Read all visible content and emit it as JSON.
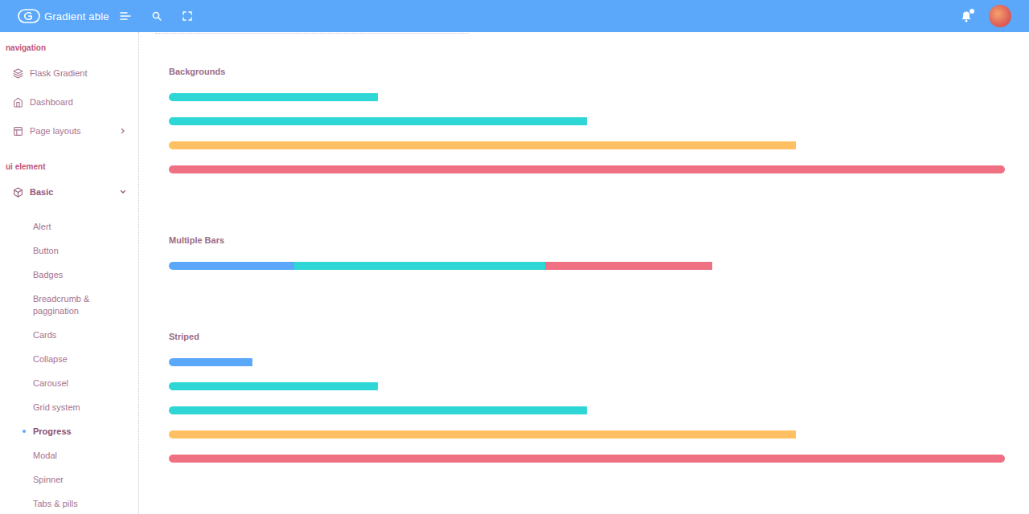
{
  "header": {
    "logo": "Gradient able"
  },
  "sidebar": {
    "groups": [
      {
        "label": "navigation",
        "items": [
          {
            "label": "Flask Gradient"
          },
          {
            "label": "Dashboard"
          },
          {
            "label": "Page layouts",
            "expanded": false
          }
        ]
      },
      {
        "label": "ui element",
        "items": [
          {
            "label": "Basic",
            "expanded": true,
            "children": [
              {
                "label": "Alert",
                "selected": false
              },
              {
                "label": "Button",
                "selected": false
              },
              {
                "label": "Badges",
                "selected": false
              },
              {
                "label": "Breadcrumb & paggination",
                "selected": false
              },
              {
                "label": "Cards",
                "selected": false
              },
              {
                "label": "Collapse",
                "selected": false
              },
              {
                "label": "Carousel",
                "selected": false
              },
              {
                "label": "Grid system",
                "selected": false
              },
              {
                "label": "Progress",
                "selected": true
              },
              {
                "label": "Modal",
                "selected": false
              },
              {
                "label": "Spinner",
                "selected": false
              },
              {
                "label": "Tabs & pills",
                "selected": false
              }
            ]
          }
        ]
      }
    ]
  },
  "sections": [
    {
      "title": "Backgrounds",
      "bars": [
        {
          "segments": [
            {
              "level": 0.25,
              "color": "#2ed6d6"
            }
          ]
        },
        {
          "segments": [
            {
              "level": 0.5,
              "color": "#2ed6d6"
            }
          ]
        },
        {
          "segments": [
            {
              "level": 0.75,
              "color": "#ffc063"
            }
          ]
        },
        {
          "segments": [
            {
              "level": 1.0,
              "color": "#f07083"
            }
          ]
        }
      ]
    },
    {
      "title": "Multiple Bars",
      "bars": [
        {
          "segments": [
            {
              "level": 0.15,
              "color": "#5ba8fb"
            },
            {
              "level": 0.3,
              "color": "#2ed6d6"
            },
            {
              "level": 0.2,
              "color": "#f07083"
            }
          ]
        }
      ]
    },
    {
      "title": "Striped",
      "bars": [
        {
          "segments": [
            {
              "level": 0.1,
              "color": "#5ba8fb"
            }
          ]
        },
        {
          "segments": [
            {
              "level": 0.25,
              "color": "#2ed6d6"
            }
          ]
        },
        {
          "segments": [
            {
              "level": 0.5,
              "color": "#2ed6d6"
            }
          ]
        },
        {
          "segments": [
            {
              "level": 0.75,
              "color": "#ffc063"
            }
          ]
        },
        {
          "segments": [
            {
              "level": 1.0,
              "color": "#f07083"
            }
          ]
        }
      ]
    }
  ]
}
